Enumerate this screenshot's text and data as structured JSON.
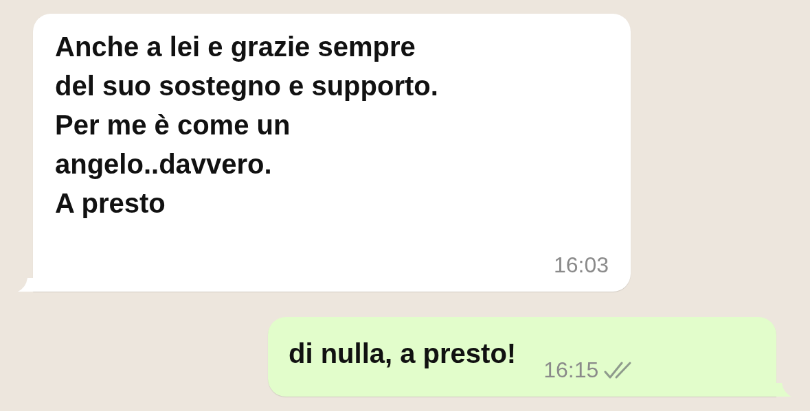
{
  "messages": [
    {
      "kind": "incoming",
      "text": "Anche a lei e grazie sempre\ndel suo sostegno e supporto.\nPer me è come un\nangelo..davvero.\nA presto",
      "time": "16:03"
    },
    {
      "kind": "outgoing",
      "text": "di nulla, a presto!",
      "time": "16:15",
      "read": false
    }
  ]
}
